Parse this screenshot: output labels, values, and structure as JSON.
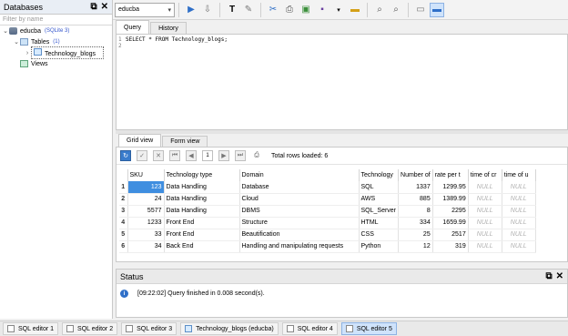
{
  "left": {
    "title": "Databases",
    "filter_placeholder": "Filter by name",
    "db_name": "educba",
    "db_info": "(SQLite 3)",
    "tables_label": "Tables",
    "tables_count": "(1)",
    "table_name": "Technology_blogs",
    "views_label": "Views"
  },
  "toolbar": {
    "db_selected": "educba"
  },
  "query_tabs": [
    "Query",
    "History"
  ],
  "editor": {
    "lines": [
      "SELECT * FROM Technology_blogs;",
      ""
    ]
  },
  "grid_tabs": [
    "Grid view",
    "Form view"
  ],
  "grid": {
    "page": "1",
    "total_rows": "Total rows loaded: 6",
    "columns": [
      "SKU",
      "Technology type",
      "Domain",
      "Technology",
      "Number of",
      "rate per t",
      "time of cr",
      "time of u"
    ],
    "rows": [
      [
        "1",
        "123",
        "Data Handling",
        "Database",
        "SQL",
        "1337",
        "1299.95",
        "NULL",
        "NULL"
      ],
      [
        "2",
        "24",
        "Data Handling",
        "Cloud",
        "AWS",
        "885",
        "1389.99",
        "NULL",
        "NULL"
      ],
      [
        "3",
        "5577",
        "Data Handling",
        "DBMS",
        "SQL_Server",
        "8",
        "2295",
        "NULL",
        "NULL"
      ],
      [
        "4",
        "1233",
        "Front End",
        "Structure",
        "HTML",
        "334",
        "1659.99",
        "NULL",
        "NULL"
      ],
      [
        "5",
        "33",
        "Front End",
        "Beautification",
        "CSS",
        "25",
        "2517",
        "NULL",
        "NULL"
      ],
      [
        "6",
        "34",
        "Back End",
        "Handling and manipulating requests",
        "Python",
        "12",
        "319",
        "NULL",
        "NULL"
      ]
    ]
  },
  "status": {
    "title": "Status",
    "message": "[09:22:02]  Query finished in 0.008 second(s)."
  },
  "bottom_tabs": [
    "SQL editor 1",
    "SQL editor 2",
    "SQL editor 3",
    "Technology_blogs (educba)",
    "SQL editor 4",
    "SQL editor 5"
  ]
}
